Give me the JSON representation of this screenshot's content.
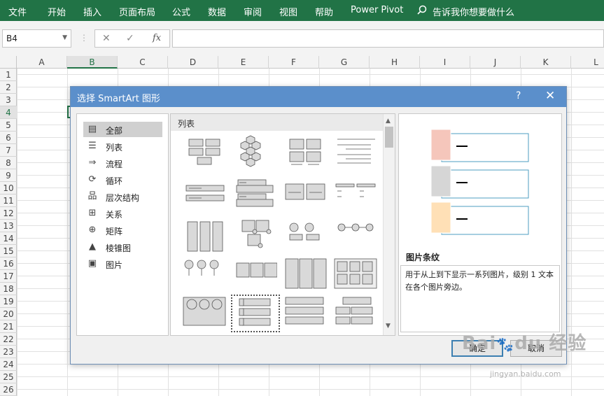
{
  "ribbon": {
    "tabs": [
      "文件",
      "开始",
      "插入",
      "页面布局",
      "公式",
      "数据",
      "审阅",
      "视图",
      "帮助",
      "Power Pivot"
    ],
    "tell_me": "告诉我你想要做什么"
  },
  "formula_bar": {
    "name_box": "B4",
    "cancel_symbol": "✕",
    "enter_symbol": "✓",
    "fx_symbol": "fx",
    "value": ""
  },
  "columns": [
    "A",
    "B",
    "C",
    "D",
    "E",
    "F",
    "G",
    "H",
    "I",
    "J",
    "K",
    "L"
  ],
  "rows": [
    "1",
    "2",
    "3",
    "4",
    "5",
    "6",
    "7",
    "8",
    "9",
    "10",
    "11",
    "12",
    "13",
    "14",
    "15",
    "16",
    "17",
    "18",
    "19",
    "20",
    "21",
    "22",
    "23",
    "24",
    "25",
    "26"
  ],
  "selected": {
    "column": "B",
    "row": "4"
  },
  "dialog": {
    "title": "选择 SmartArt 图形",
    "help": "?",
    "close": "✕",
    "categories": [
      {
        "label": "全部",
        "icon": "all-icon",
        "selected": true
      },
      {
        "label": "列表",
        "icon": "list-icon",
        "selected": false
      },
      {
        "label": "流程",
        "icon": "process-icon",
        "selected": false
      },
      {
        "label": "循环",
        "icon": "cycle-icon",
        "selected": false
      },
      {
        "label": "层次结构",
        "icon": "hierarchy-icon",
        "selected": false
      },
      {
        "label": "关系",
        "icon": "relationship-icon",
        "selected": false
      },
      {
        "label": "矩阵",
        "icon": "matrix-icon",
        "selected": false
      },
      {
        "label": "棱锥图",
        "icon": "pyramid-icon",
        "selected": false
      },
      {
        "label": "图片",
        "icon": "picture-icon",
        "selected": false
      }
    ],
    "layout_header": "列表",
    "preview_title": "图片条纹",
    "preview_description": "用于从上到下显示一系列图片，级别 1 文本在各个图片旁边。",
    "ok_label": "确定",
    "cancel_label": "取消",
    "preview_colors": [
      "#f5c6bb",
      "#d6d6d6",
      "#ffe0b6"
    ],
    "accent_border": "#4d9ec2"
  },
  "watermark": {
    "text": "Baidu经验",
    "sub": "jingyan.baidu.com"
  }
}
